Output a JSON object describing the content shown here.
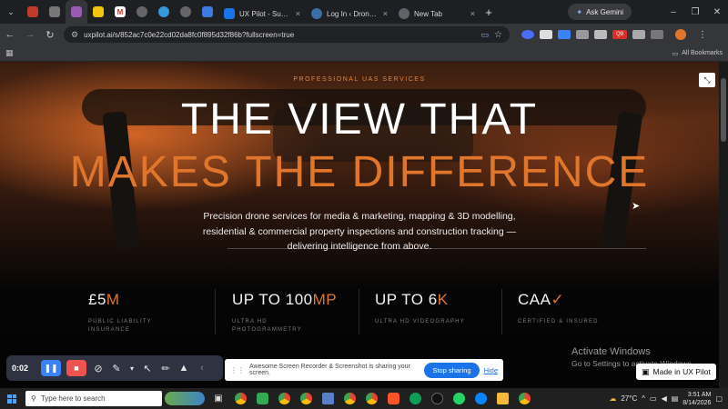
{
  "browser": {
    "tabs": [
      {
        "title": "UX Pilot - Superfast U",
        "favicon_color": "#1a73e8"
      },
      {
        "title": "Log In ‹ Drone Servic",
        "favicon_color": "#3a6ea5"
      },
      {
        "title": "New Tab",
        "favicon_color": "#5f6368"
      }
    ],
    "new_tab_label": "+",
    "gemini_label": "Ask Gemini",
    "url": "uxpilot.ai/s/852ac7c0e22cd02da8fc0f895d32f86b?fullscreen=true",
    "all_bookmarks_label": "All Bookmarks",
    "profile_badge": "Q9"
  },
  "hero": {
    "eyebrow": "PROFESSIONAL UAS SERVICES",
    "headline_1": "THE VIEW THAT",
    "headline_2": "MAKES THE DIFFERENCE",
    "lede": "Precision drone services for media & marketing, mapping & 3D modelling, residential & commercial property inspections and construction tracking — delivering intelligence from above."
  },
  "stats": [
    {
      "value": "£5",
      "accent": "M",
      "label": "PUBLIC LIABILITY INSURANCE"
    },
    {
      "value": "UP TO 100",
      "accent": "MP",
      "label": "ULTRA HD PHOTOGRAMMETRY"
    },
    {
      "value": "UP TO 6",
      "accent": "K",
      "label": "ULTRA HD VIDEOGRAPHY"
    },
    {
      "value": "CAA",
      "accent": "✓",
      "label": "CERTIFIED & INSURED"
    }
  ],
  "watermark": {
    "title": "Activate Windows",
    "subtitle": "Go to Settings to activate Windows."
  },
  "recorder": {
    "time": "0:02",
    "share_message": "Awesome Screen Recorder & Screenshot is sharing your screen.",
    "stop_label": "Stop sharing",
    "hide_label": "Hide"
  },
  "ux_badge": "Made in UX Pilot",
  "taskbar": {
    "search_placeholder": "Type here to search",
    "weather": "27°C",
    "time": "3:51 AM",
    "date": "8/14/2026"
  }
}
